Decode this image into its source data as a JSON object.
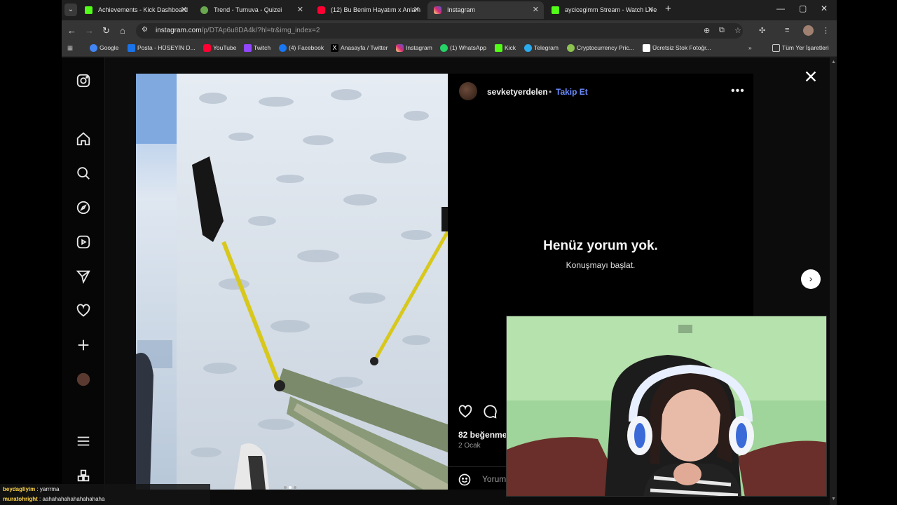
{
  "tabs": [
    {
      "title": "Achievements - Kick Dashboard",
      "icon": "kick-icon",
      "color": "#53fc18"
    },
    {
      "title": "Trend - Turnuva - Quizei",
      "icon": "quizei-icon",
      "color": "#6aa84f"
    },
    {
      "title": "(12) Bu Benim Hayatım x Anlam",
      "icon": "youtube-icon",
      "color": "#ff0033"
    },
    {
      "title": "Instagram",
      "icon": "instagram-icon",
      "color": "#e1306c"
    },
    {
      "title": "aycicegimm Stream - Watch Live",
      "icon": "kick-icon",
      "color": "#53fc18"
    }
  ],
  "address": {
    "domain": "instagram.com",
    "path": "/p/DTAp6u8DA4k/?hl=tr&img_index=2"
  },
  "bookmarks": [
    {
      "label": "Google",
      "icon": "google-icon",
      "color": "#4285f4"
    },
    {
      "label": "Posta - HÜSEYİN D...",
      "icon": "mail-icon",
      "color": "#1a73e8"
    },
    {
      "label": "YouTube",
      "icon": "youtube-icon",
      "color": "#ff0033"
    },
    {
      "label": "Twitch",
      "icon": "twitch-icon",
      "color": "#9146ff"
    },
    {
      "label": "(4) Facebook",
      "icon": "facebook-icon",
      "color": "#1877f2"
    },
    {
      "label": "Anasayfa / Twitter",
      "icon": "x-icon",
      "color": "#ffffff"
    },
    {
      "label": "Instagram",
      "icon": "instagram-icon",
      "color": "#e1306c"
    },
    {
      "label": "(1) WhatsApp",
      "icon": "whatsapp-icon",
      "color": "#25d366"
    },
    {
      "label": "Kick",
      "icon": "kick-icon",
      "color": "#53fc18"
    },
    {
      "label": "Telegram",
      "icon": "telegram-icon",
      "color": "#2aabee"
    },
    {
      "label": "Cryptocurrency Pric...",
      "icon": "coin-icon",
      "color": "#8dc351"
    },
    {
      "label": "Ücretsiz Stok Fotoğr...",
      "icon": "pexels-icon",
      "color": "#ffffff"
    }
  ],
  "bookmarks_all": "Tüm Yer İşaretleri",
  "post": {
    "author": "sevketyerdelen",
    "separator": "•",
    "follow_label": "Takip Et",
    "empty_title": "Henüz yorum yok.",
    "empty_sub": "Konuşmayı başlat.",
    "likes": "82 beğenme",
    "date": "2 Ocak",
    "comment_placeholder": "Yorum ekle...",
    "image_index": 2,
    "image_count": 3
  },
  "chat": [
    {
      "user": "beydagliyim",
      "text": " : yarrrma"
    },
    {
      "user": "muratohright",
      "text": " : aahahahahahahahahaha"
    }
  ],
  "colors": {
    "accent": "#6b8cff",
    "background": "#0c0c0c"
  }
}
